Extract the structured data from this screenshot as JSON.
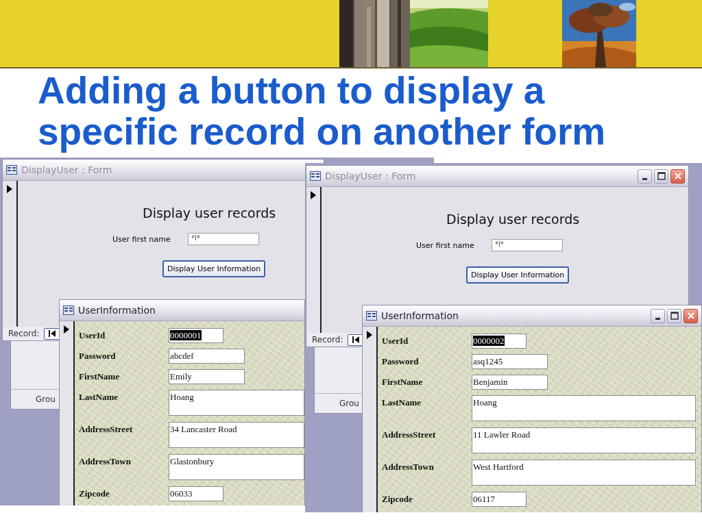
{
  "slide": {
    "title": "Adding a button to display a specific record on another form"
  },
  "screenshots": [
    {
      "window_buttons": false,
      "behind_label": "Grou",
      "display_form": {
        "title": "DisplayUser : Form",
        "active": false,
        "heading": "Display user records",
        "field_label": "User first name",
        "field_value": "*l*",
        "button": "Display User Information",
        "record_label": "Record:"
      },
      "user_form": {
        "title": "UserInformation",
        "active": true,
        "fields": [
          {
            "label": "UserId",
            "value": "0000001",
            "kind": "code",
            "selected": true
          },
          {
            "label": "Password",
            "value": "abcdef",
            "kind": "short",
            "selected": false
          },
          {
            "label": "FirstName",
            "value": "Emily",
            "kind": "short",
            "selected": false
          },
          {
            "label": "LastName",
            "value": "Hoang",
            "kind": "multiline",
            "selected": false
          },
          {
            "label": "AddressStreet",
            "value": "34 Lancaster Road",
            "kind": "multiline",
            "selected": false
          },
          {
            "label": "AddressTown",
            "value": "Glastonbury",
            "kind": "multiline",
            "selected": false
          },
          {
            "label": "Zipcode",
            "value": "06033",
            "kind": "code",
            "selected": false
          }
        ]
      }
    },
    {
      "window_buttons": true,
      "behind_label": "Grou",
      "display_form": {
        "title": "DisplayUser : Form",
        "active": false,
        "heading": "Display user records",
        "field_label": "User first name",
        "field_value": "*l*",
        "button": "Display User Information",
        "record_label": "Record:"
      },
      "user_form": {
        "title": "UserInformation",
        "active": true,
        "fields": [
          {
            "label": "UserId",
            "value": "0000002",
            "kind": "code",
            "selected": true
          },
          {
            "label": "Password",
            "value": "asq1245",
            "kind": "short",
            "selected": false
          },
          {
            "label": "FirstName",
            "value": "Benjamin",
            "kind": "short",
            "selected": false
          },
          {
            "label": "LastName",
            "value": "Hoang",
            "kind": "multiline",
            "selected": false
          },
          {
            "label": "AddressStreet",
            "value": "11 Lawler Road",
            "kind": "multiline",
            "selected": false
          },
          {
            "label": "AddressTown",
            "value": "West Hartford",
            "kind": "multiline",
            "selected": false
          },
          {
            "label": "Zipcode",
            "value": "06117",
            "kind": "code",
            "selected": false
          }
        ]
      }
    }
  ]
}
